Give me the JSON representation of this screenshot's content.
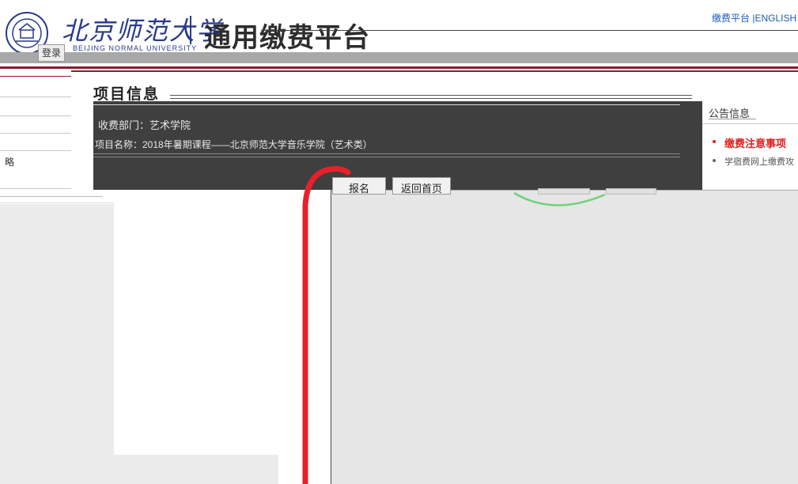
{
  "header": {
    "logo_icon": "university-seal-icon",
    "university_name": "北京师范大学",
    "university_en": "BEIJING NORMAL UNIVERSITY",
    "platform_title": "通用缴费平台",
    "links": [
      "缴费平台",
      "|ENGLISH"
    ],
    "login_label": "登录"
  },
  "nav": {
    "partial_item": "略"
  },
  "project": {
    "heading": "项目信息",
    "department": "收费部门：艺术学院",
    "project_name": "项目名称：2018年暑期课程——北京师范大学音乐学院（艺术类）",
    "buttons": {
      "signup": "报名",
      "home": "返回首页"
    }
  },
  "notice": {
    "title": "公告信息",
    "items": [
      "缴费注意事项",
      "学宿费网上缴费攻"
    ],
    "colors": {
      "highlight": "#e02020",
      "normal": "#555555"
    }
  },
  "colors": {
    "accent_maroon": "#8b1c2f",
    "link_blue": "#1e5bb5",
    "school_blue": "#273a8a",
    "annotation_red": "#e8202a",
    "annotation_green": "#6fd27a"
  }
}
